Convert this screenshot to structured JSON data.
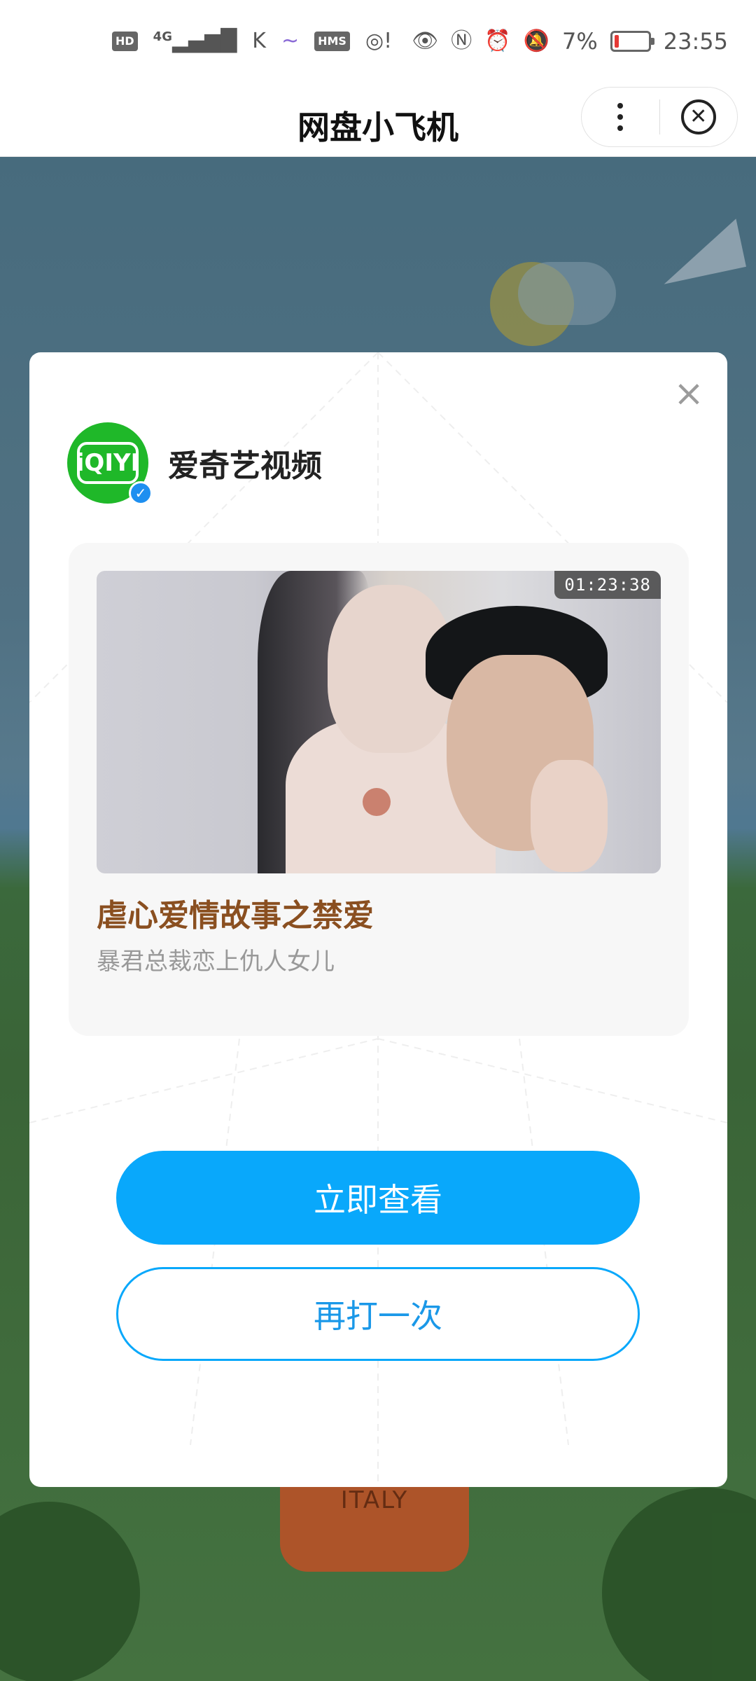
{
  "status_bar": {
    "left_icons": [
      "hd-icon",
      "signal-4g-icon",
      "k-icon",
      "wave-icon",
      "hms-icon",
      "wireless-icon"
    ],
    "hd_label": "HD",
    "network_label": "4G",
    "hms_label": "HMS",
    "battery_percent": "7%",
    "time": "23:55"
  },
  "titlebar": {
    "title": "网盘小飞机"
  },
  "dialog": {
    "brand": {
      "name": "爱奇艺视频",
      "logo_text": "iQIYI"
    },
    "video": {
      "duration": "01:23:38",
      "title": "虐心爱情故事之禁爱",
      "subtitle": "暴君总裁恋上仇人女儿"
    },
    "primary_button": "立即查看",
    "secondary_button": "再打一次"
  },
  "background": {
    "trophy_text": "ITALY"
  },
  "colors": {
    "accent": "#09a8fb",
    "title_brown": "#8a4f20",
    "brand_green": "#1fb829"
  }
}
